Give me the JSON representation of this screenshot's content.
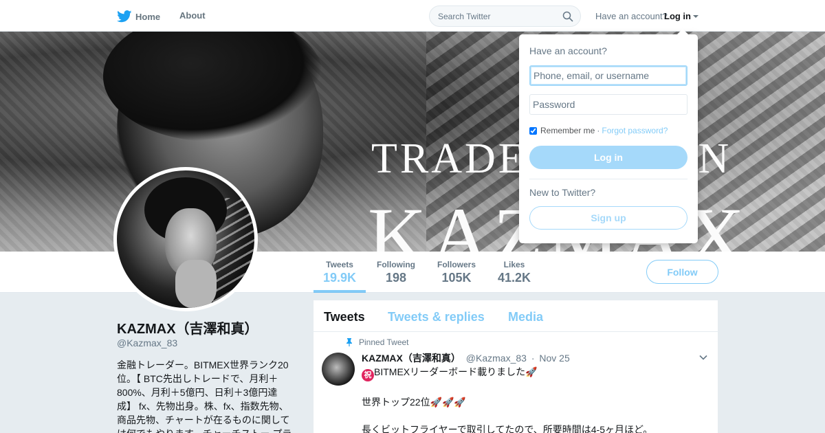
{
  "colors": {
    "brand_blue": "#1da1f2",
    "text_primary": "#14171a",
    "text_secondary": "#657786",
    "page_bg": "#e6ecf0"
  },
  "topnav": {
    "home_label": "Home",
    "about_label": "About",
    "search_placeholder": "Search Twitter",
    "have_account": "Have an account?",
    "login_label": "Log in"
  },
  "banner": {
    "line1": "TRADE",
    "line1_right": "ON",
    "line2": "KAZMAX"
  },
  "stats": [
    {
      "label": "Tweets",
      "value": "19.9K"
    },
    {
      "label": "Following",
      "value": "198"
    },
    {
      "label": "Followers",
      "value": "105K"
    },
    {
      "label": "Likes",
      "value": "41.2K"
    }
  ],
  "follow_label": "Follow",
  "profile": {
    "name": "KAZMAX（吉澤和真）",
    "handle": "@Kazmax_83",
    "bio": "金融トレーダー。BITMEX世界ランク20位。【 BTC先出しトレードで、月利＋800%、月利＋5億円、日利＋3億円達成】 fx、先物出身。株、fx、指数先物、商品先物、チャートが在るものに関しては何でもやります。チャーチストー プラ"
  },
  "timeline": {
    "tabs": [
      "Tweets",
      "Tweets & replies",
      "Media"
    ],
    "pinned_label": "Pinned Tweet",
    "tweet": {
      "name": "KAZMAX（吉澤和真）",
      "handle": "@Kazmax_83",
      "separator": "·",
      "date": "Nov 25",
      "badge": "祝",
      "lines": [
        "BITMEXリーダーボード載りました🚀",
        "世界トップ22位🚀🚀🚀",
        "長くビットフライヤーで取引してたので、所要時間は4-5ヶ月ほど。"
      ]
    }
  },
  "login_dropdown": {
    "title": "Have an account?",
    "username_placeholder": "Phone, email, or username",
    "password_placeholder": "Password",
    "remember_label": "Remember me",
    "separator": "·",
    "forgot_label": "Forgot password?",
    "login_button": "Log in",
    "new_label": "New to Twitter?",
    "signup_button": "Sign up"
  }
}
